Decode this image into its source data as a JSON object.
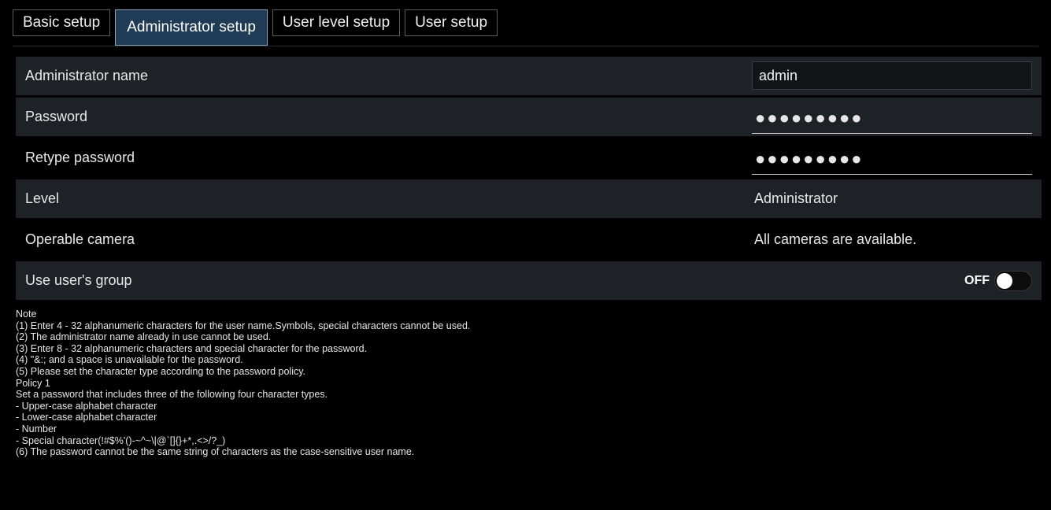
{
  "tabs": [
    {
      "label": "Basic setup",
      "active": false
    },
    {
      "label": "Administrator setup",
      "active": true
    },
    {
      "label": "User level setup",
      "active": false
    },
    {
      "label": "User setup",
      "active": false
    }
  ],
  "admin_name": {
    "label": "Administrator name",
    "value": "admin"
  },
  "password": {
    "label": "Password",
    "masked": "●●●●●●●●●"
  },
  "retype_password": {
    "label": "Retype password",
    "masked": "●●●●●●●●●"
  },
  "level": {
    "label": "Level",
    "value": "Administrator"
  },
  "operable_camera": {
    "label": "Operable camera",
    "value": "All cameras are available."
  },
  "use_group": {
    "label": "Use user's group",
    "state": "OFF"
  },
  "notes": [
    "Note",
    "(1) Enter 4 - 32 alphanumeric characters for the user name.Symbols, special characters cannot be used.",
    "(2) The administrator name already in use cannot be used.",
    "(3) Enter 8 - 32 alphanumeric characters and special character for the password.",
    "(4) \"&:; and a space is unavailable for the password.",
    "(5) Please set the character type according to the password policy.",
    "Policy 1",
    "Set a password that includes three of the following four character types.",
    "- Upper-case alphabet character",
    "- Lower-case alphabet character",
    "- Number",
    "- Special character(!#$%'()-~^~\\|@`[]{}+*,.<>/?_)",
    "(6) The password cannot be the same string of characters as the case-sensitive user name."
  ]
}
